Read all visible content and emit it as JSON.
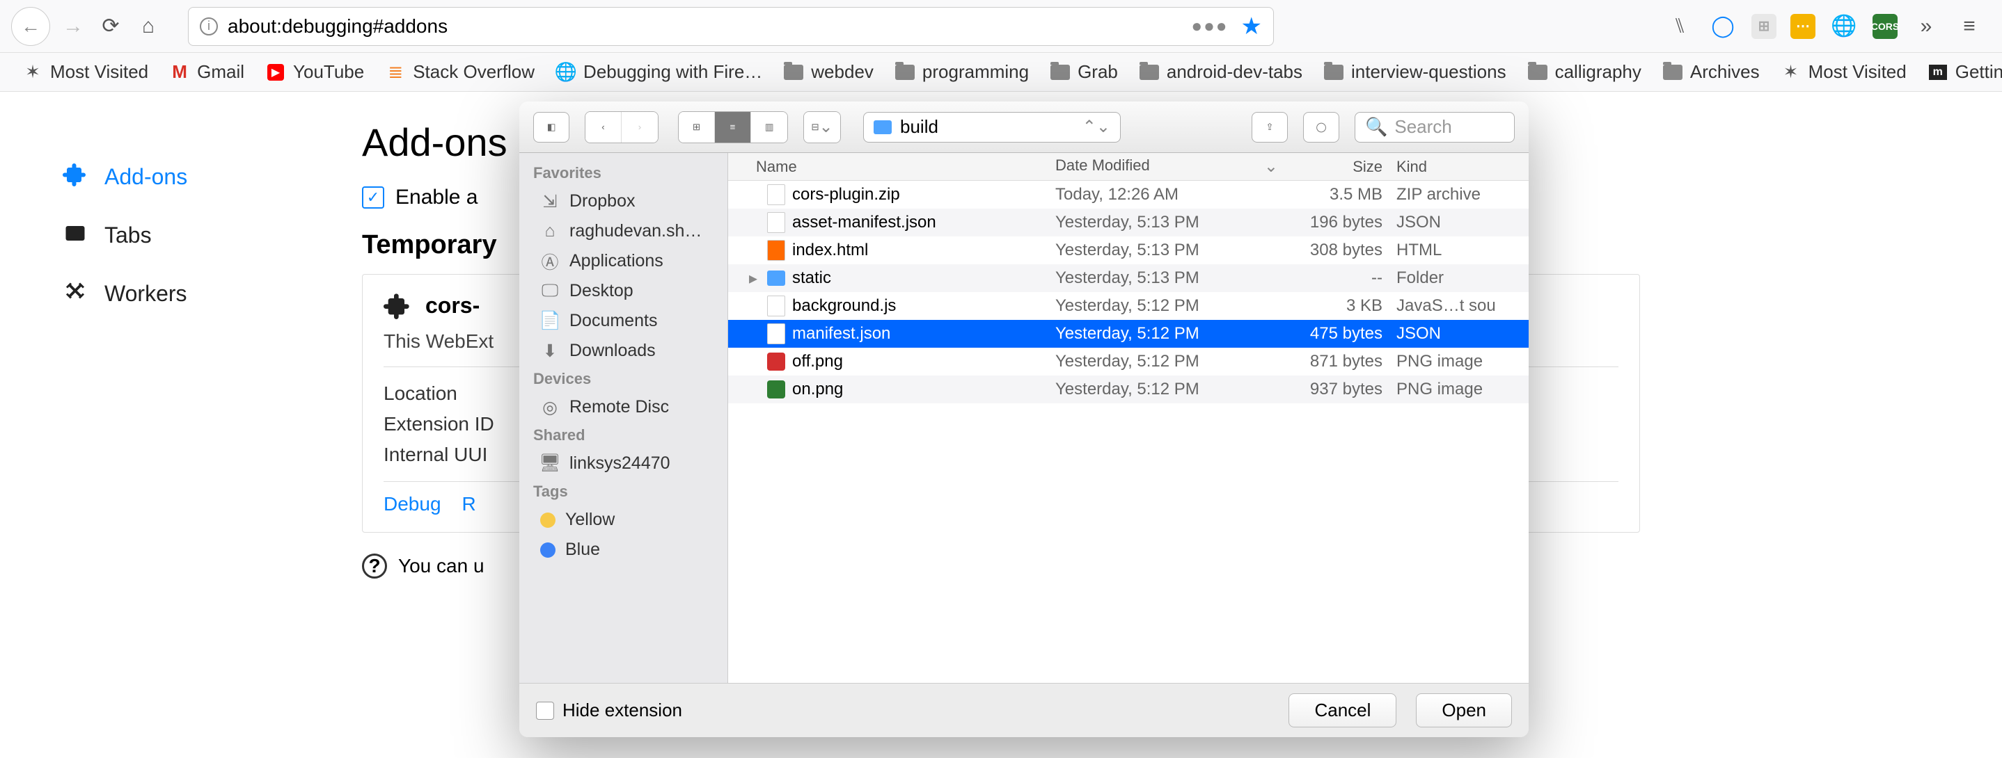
{
  "browser": {
    "url": "about:debugging#addons",
    "toolbar_icons": [
      "library",
      "circle",
      "grid",
      "box",
      "globe",
      "cors",
      "more",
      "menu"
    ]
  },
  "bookmarks": [
    {
      "icon": "star",
      "label": "Most Visited"
    },
    {
      "icon": "gmail",
      "label": "Gmail"
    },
    {
      "icon": "youtube",
      "label": "YouTube"
    },
    {
      "icon": "so",
      "label": "Stack Overflow"
    },
    {
      "icon": "globe",
      "label": "Debugging with Fire…"
    },
    {
      "icon": "folder",
      "label": "webdev"
    },
    {
      "icon": "folder",
      "label": "programming"
    },
    {
      "icon": "folder",
      "label": "Grab"
    },
    {
      "icon": "folder",
      "label": "android-dev-tabs"
    },
    {
      "icon": "folder",
      "label": "interview-questions"
    },
    {
      "icon": "folder",
      "label": "calligraphy"
    },
    {
      "icon": "folder",
      "label": "Archives"
    },
    {
      "icon": "star",
      "label": "Most Visited"
    },
    {
      "icon": "m",
      "label": "Getting Started"
    }
  ],
  "page": {
    "title": "Add-ons",
    "enable_label": "Enable a",
    "sidebar": [
      {
        "label": "Add-ons",
        "active": true
      },
      {
        "label": "Tabs",
        "active": false
      },
      {
        "label": "Workers",
        "active": false
      }
    ],
    "section_heading": "Temporary",
    "card": {
      "title": "cors-",
      "subtitle": "This WebExt",
      "rows": [
        "Location",
        "Extension ID",
        "Internal UUI"
      ],
      "links": [
        "Debug",
        "R"
      ]
    },
    "info_text": "You can u"
  },
  "dialog": {
    "folder": "build",
    "search_placeholder": "Search",
    "sidebar": {
      "favorites_label": "Favorites",
      "favorites": [
        "Dropbox",
        "raghudevan.sh…",
        "Applications",
        "Desktop",
        "Documents",
        "Downloads"
      ],
      "devices_label": "Devices",
      "devices": [
        "Remote Disc"
      ],
      "shared_label": "Shared",
      "shared": [
        "linksys24470"
      ],
      "tags_label": "Tags",
      "tags": [
        {
          "label": "Yellow",
          "color": "#f7c948"
        },
        {
          "label": "Blue",
          "color": "#3b82f6"
        }
      ]
    },
    "columns": {
      "name": "Name",
      "date": "Date Modified",
      "size": "Size",
      "kind": "Kind"
    },
    "files": [
      {
        "name": "cors-plugin.zip",
        "date": "Today, 12:26 AM",
        "size": "3.5 MB",
        "kind": "ZIP archive",
        "icon": "file",
        "selected": false
      },
      {
        "name": "asset-manifest.json",
        "date": "Yesterday, 5:13 PM",
        "size": "196 bytes",
        "kind": "JSON",
        "icon": "file",
        "selected": false
      },
      {
        "name": "index.html",
        "date": "Yesterday, 5:13 PM",
        "size": "308 bytes",
        "kind": "HTML",
        "icon": "html",
        "selected": false
      },
      {
        "name": "static",
        "date": "Yesterday, 5:13 PM",
        "size": "--",
        "kind": "Folder",
        "icon": "folder",
        "selected": false,
        "expandable": true
      },
      {
        "name": "background.js",
        "date": "Yesterday, 5:12 PM",
        "size": "3 KB",
        "kind": "JavaS…t sou",
        "icon": "file",
        "selected": false
      },
      {
        "name": "manifest.json",
        "date": "Yesterday, 5:12 PM",
        "size": "475 bytes",
        "kind": "JSON",
        "icon": "file",
        "selected": true
      },
      {
        "name": "off.png",
        "date": "Yesterday, 5:12 PM",
        "size": "871 bytes",
        "kind": "PNG image",
        "icon": "png-red",
        "selected": false
      },
      {
        "name": "on.png",
        "date": "Yesterday, 5:12 PM",
        "size": "937 bytes",
        "kind": "PNG image",
        "icon": "png-green",
        "selected": false
      }
    ],
    "hide_ext": "Hide extension",
    "cancel": "Cancel",
    "open": "Open"
  }
}
